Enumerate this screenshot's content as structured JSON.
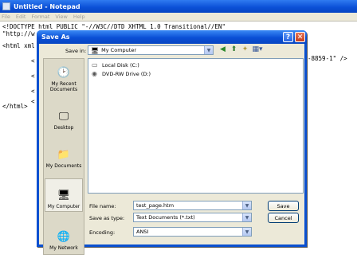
{
  "notepad": {
    "title": "Untitled - Notepad",
    "menu": [
      "File",
      "Edit",
      "Format",
      "View",
      "Help"
    ],
    "lines": [
      "<!DOCTYPE html PUBLIC \"-//W3C//DTD XHTML 1.0 Transitional//EN\"",
      "\"http://w",
      "<html xml",
      "<",
      "<",
      "<",
      "<",
      "</html>"
    ],
    "right_fragment": "-8859-1\" />"
  },
  "dialog": {
    "title": "Save As",
    "save_in_label": "Save in:",
    "save_in_value": "My Computer",
    "places": [
      "My Recent Documents",
      "Desktop",
      "My Documents",
      "My Computer",
      "My Network"
    ],
    "files": [
      "Local Disk (C:)",
      "DVD-RW Drive (D:)"
    ],
    "file_name_label": "File name:",
    "file_name_value": "test_page.htm",
    "save_as_type_label": "Save as type:",
    "save_as_type_value": "Text Documents (*.txt)",
    "encoding_label": "Encoding:",
    "encoding_value": "ANSI",
    "save_button": "Save",
    "cancel_button": "Cancel",
    "help_glyph": "?",
    "close_glyph": "✕"
  }
}
